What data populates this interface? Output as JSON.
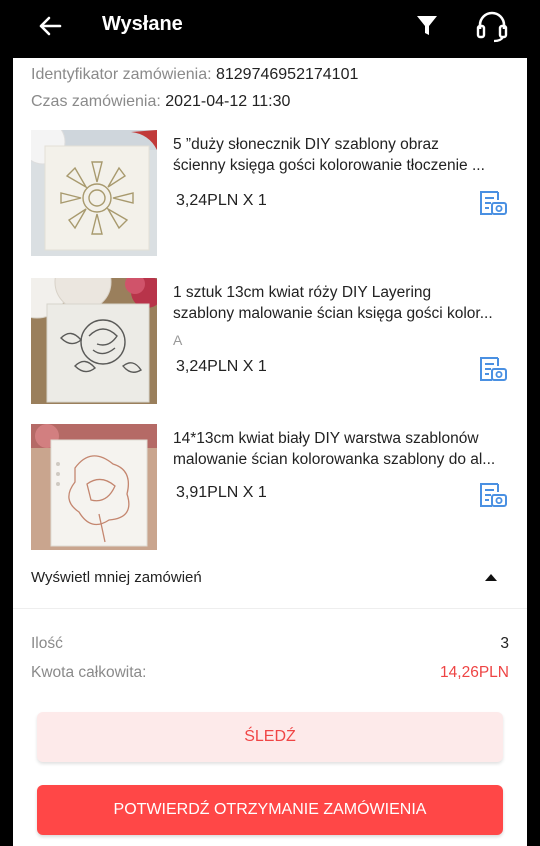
{
  "header": {
    "title": "Wysłane"
  },
  "order": {
    "id_label": "Identyfikator zamówienia:",
    "id_value": "8129746952174101",
    "time_label": "Czas zamówienia:",
    "time_value": "2021-04-12 11:30"
  },
  "items": [
    {
      "name_line1": "5 ”duży słonecznik DIY szablony obraz",
      "name_line2": "ścienny księga gości kolorowanie tłoczenie ...",
      "variant": "",
      "price": "3,24PLN X 1"
    },
    {
      "name_line1": "1 sztuk 13cm kwiat róży DIY Layering",
      "name_line2": "szablony malowanie ścian księga gości kolor...",
      "variant": "A",
      "price": "3,24PLN X 1"
    },
    {
      "name_line1": "14*13cm kwiat biały DIY warstwa szablonów",
      "name_line2": "malowanie ścian kolorowanka szablony do al...",
      "variant": "",
      "price": "3,91PLN X 1"
    }
  ],
  "show_less": "Wyświetl mniej zamówień",
  "summary": {
    "qty_label": "Ilość",
    "qty_value": "3",
    "total_label": "Kwota całkowita:",
    "total_value": "14,26PLN"
  },
  "actions": {
    "track": "ŚLEDŹ",
    "confirm": "POTWIERDŹ OTRZYMANIE ZAMÓWIENIA"
  },
  "colors": {
    "accent": "#ff4747",
    "total": "#ee4444",
    "review_icon": "#4a90e2",
    "track_bg": "#fdeaea"
  },
  "icons": {
    "back": "back-arrow-icon",
    "filter": "filter-icon",
    "support": "headset-icon",
    "review": "photo-review-icon",
    "collapse": "caret-up-icon"
  }
}
